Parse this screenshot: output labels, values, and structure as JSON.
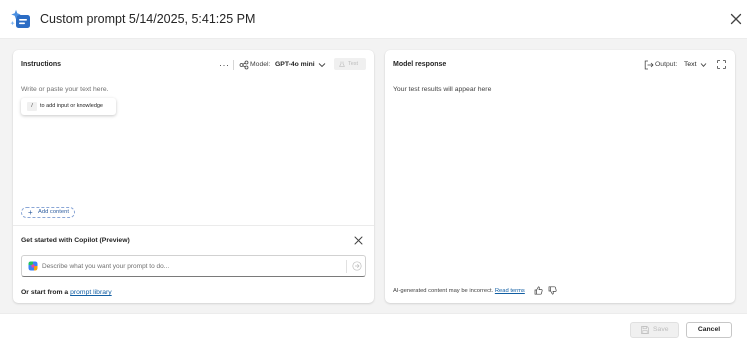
{
  "header": {
    "title": "Custom prompt 5/14/2025, 5:41:25 PM",
    "icons": {
      "app": "prompt-sparkle-icon",
      "close": "close-icon"
    }
  },
  "instructions_panel": {
    "title": "Instructions",
    "more_label": "···",
    "model_label": "Model:",
    "model_value": "GPT-4o mini",
    "test_label": "Test",
    "placeholder": "Write or paste your text here.",
    "hint_key": "/",
    "hint_text": "to add input or knowledge",
    "add_content_label": "Add content",
    "icons": {
      "model": "model-icon",
      "test": "flask-icon",
      "chevron": "chevron-down-icon",
      "add": "plus-icon"
    }
  },
  "copilot_section": {
    "title": "Get started with Copilot (Preview)",
    "describe_placeholder": "Describe what you want your prompt to do...",
    "library_prefix": "Or start from a",
    "library_link": "prompt library",
    "icons": {
      "close": "close-icon",
      "copilot": "copilot-logo-icon",
      "send": "send-icon"
    }
  },
  "response_panel": {
    "title": "Model response",
    "output_label": "Output:",
    "output_value": "Text",
    "placeholder": "Your test results will appear here",
    "disclaimer": "AI-generated content may be incorrect.",
    "read_terms": "Read terms",
    "icons": {
      "output": "output-icon",
      "expand": "expand-icon",
      "like": "thumb-up-icon",
      "dislike": "thumb-down-icon"
    }
  },
  "footer": {
    "save_label": "Save",
    "cancel_label": "Cancel",
    "icons": {
      "save": "save-icon"
    }
  },
  "colors": {
    "accent": "#115ea3",
    "background": "#f3f3f3",
    "panel": "#ffffff",
    "disabled_text": "#bdbdbd"
  }
}
